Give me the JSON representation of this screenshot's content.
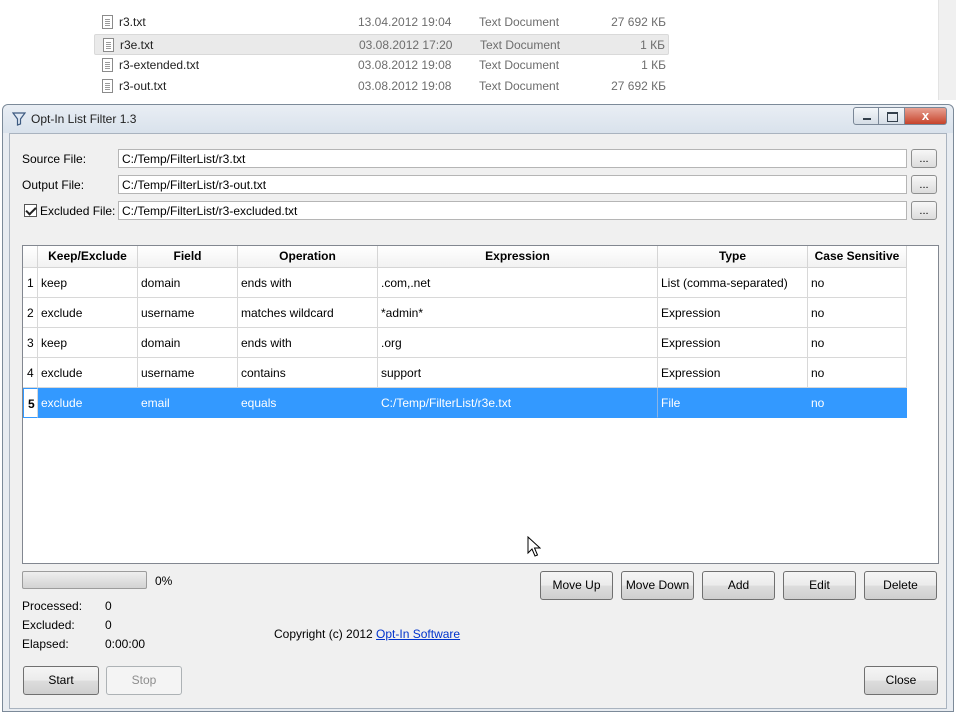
{
  "explorer": {
    "files": [
      {
        "name": "r3.txt",
        "date": "13.04.2012 19:04",
        "type": "Text Document",
        "size": "27 692 КБ",
        "selected": false
      },
      {
        "name": "r3e.txt",
        "date": "03.08.2012 17:20",
        "type": "Text Document",
        "size": "1 КБ",
        "selected": true
      },
      {
        "name": "r3-extended.txt",
        "date": "03.08.2012 19:08",
        "type": "Text Document",
        "size": "1 КБ",
        "selected": false
      },
      {
        "name": "r3-out.txt",
        "date": "03.08.2012 19:08",
        "type": "Text Document",
        "size": "27 692 КБ",
        "selected": false
      }
    ]
  },
  "window": {
    "title": "Opt-In List Filter 1.3",
    "icon": "funnel-icon",
    "close_glyph": "x"
  },
  "files": {
    "source_label": "Source File:",
    "source_value": "C:/Temp/FilterList/r3.txt",
    "output_label": "Output File:",
    "output_value": "C:/Temp/FilterList/r3-out.txt",
    "excluded_label": "Excluded File:",
    "excluded_value": "C:/Temp/FilterList/r3-excluded.txt",
    "excluded_checked": true,
    "browse_label": "..."
  },
  "table": {
    "columns": [
      "Keep/Exclude",
      "Field",
      "Operation",
      "Expression",
      "Type",
      "Case Sensitive"
    ],
    "rows": [
      {
        "index": "1",
        "cells": [
          "keep",
          "domain",
          "ends with",
          ".com,.net",
          "List (comma-separated)",
          "no"
        ]
      },
      {
        "index": "2",
        "cells": [
          "exclude",
          "username",
          "matches wildcard",
          "*admin*",
          "Expression",
          "no"
        ]
      },
      {
        "index": "3",
        "cells": [
          "keep",
          "domain",
          "ends with",
          ".org",
          "Expression",
          "no"
        ]
      },
      {
        "index": "4",
        "cells": [
          "exclude",
          "username",
          "contains",
          "support",
          "Expression",
          "no"
        ]
      },
      {
        "index": "5",
        "cells": [
          "exclude",
          "email",
          "equals",
          "C:/Temp/FilterList/r3e.txt",
          "File",
          "no"
        ]
      }
    ],
    "selected_row": 5
  },
  "progress": {
    "value_fraction": 0.0,
    "label": "0%"
  },
  "stats": {
    "processed_label": "Processed:",
    "processed_value": "0",
    "excluded_label": "Excluded:",
    "excluded_value": "0",
    "elapsed_label": "Elapsed:",
    "elapsed_value": "0:00:00"
  },
  "buttons": {
    "move_up": "Move Up",
    "move_down": "Move Down",
    "add": "Add",
    "edit": "Edit",
    "delete": "Delete",
    "start": "Start",
    "stop": "Stop",
    "close": "Close"
  },
  "copyright": {
    "text": "Copyright (c) 2012 ",
    "link": "Opt-In Software"
  },
  "colors": {
    "selection": "#3399ff",
    "progress_fill": "#3cb43c",
    "link": "#0033cc"
  }
}
